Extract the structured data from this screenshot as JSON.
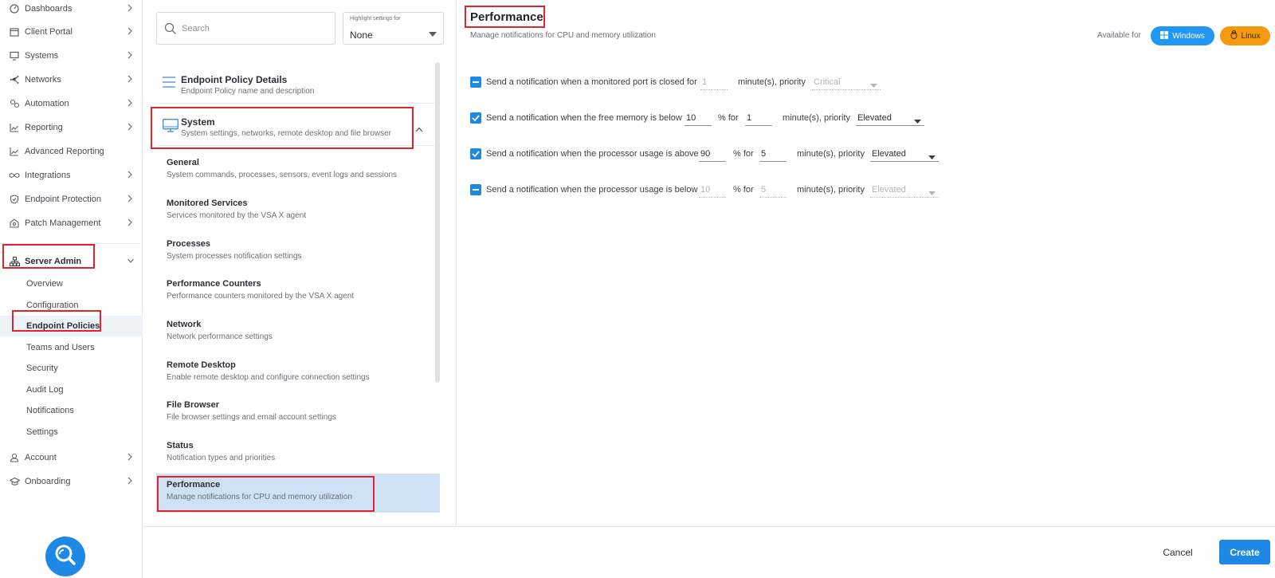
{
  "nav": {
    "items": [
      {
        "label": "Dashboards",
        "icon": "dashboard-icon"
      },
      {
        "label": "Client Portal",
        "icon": "window-icon"
      },
      {
        "label": "Systems",
        "icon": "monitor-icon"
      },
      {
        "label": "Networks",
        "icon": "network-icon"
      },
      {
        "label": "Automation",
        "icon": "automation-icon"
      },
      {
        "label": "Reporting",
        "icon": "chart-icon"
      },
      {
        "label": "Advanced Reporting",
        "icon": "chart-icon"
      },
      {
        "label": "Integrations",
        "icon": "infinity-icon"
      },
      {
        "label": "Endpoint Protection",
        "icon": "shield-icon"
      },
      {
        "label": "Patch Management",
        "icon": "patch-icon"
      }
    ],
    "server_admin": "Server Admin",
    "sub_items": [
      "Overview",
      "Configuration",
      "Endpoint Policies",
      "Teams and Users",
      "Security",
      "Audit Log",
      "Notifications",
      "Settings"
    ],
    "account": "Account",
    "onboarding": "Onboarding"
  },
  "middle": {
    "search_placeholder": "Search",
    "highlight_label": "Highlight settings for",
    "highlight_value": "None",
    "sections": [
      {
        "title": "Endpoint Policy Details",
        "desc": "Endpoint Policy name and description"
      },
      {
        "title": "System",
        "desc": "System settings, networks, remote desktop and file browser"
      }
    ],
    "entries": [
      {
        "title": "General",
        "desc": "System commands, processes, sensors, event logs and sessions"
      },
      {
        "title": "Monitored Services",
        "desc": "Services monitored by the VSA X agent"
      },
      {
        "title": "Processes",
        "desc": "System processes notification settings"
      },
      {
        "title": "Performance Counters",
        "desc": "Performance counters monitored by the VSA X agent"
      },
      {
        "title": "Network",
        "desc": "Network performance settings"
      },
      {
        "title": "Remote Desktop",
        "desc": "Enable remote desktop and configure connection settings"
      },
      {
        "title": "File Browser",
        "desc": "File browser settings and email account settings"
      },
      {
        "title": "Status",
        "desc": "Notification types and priorities"
      },
      {
        "title": "Performance",
        "desc": "Manage notifications for CPU and memory utilization"
      }
    ]
  },
  "content": {
    "title": "Performance",
    "subtitle": "Manage notifications for CPU and memory utilization",
    "available_for": "Available for",
    "windows": "Windows",
    "linux": "Linux",
    "rules": [
      {
        "text": "Send a notification when a monitored port is closed for",
        "value1": "1",
        "unit": "minute(s), priority",
        "priority": "Critical",
        "state": "partial"
      },
      {
        "text": "Send a notification when the free memory is below",
        "value1": "10",
        "mid": "% for",
        "value2": "1",
        "unit": "minute(s), priority",
        "priority": "Elevated",
        "state": "checked"
      },
      {
        "text": "Send a notification when the processor usage is above",
        "value1": "90",
        "mid": "% for",
        "value2": "5",
        "unit": "minute(s), priority",
        "priority": "Elevated",
        "state": "checked"
      },
      {
        "text": "Send a notification when the processor usage is below",
        "value1": "10",
        "mid": "% for",
        "value2": "5",
        "unit": "minute(s), priority",
        "priority": "Elevated",
        "state": "partial"
      }
    ]
  },
  "footer": {
    "cancel": "Cancel",
    "create": "Create"
  },
  "colors": {
    "accent": "#1e88e5",
    "highlight_box": "#e0242e",
    "linux": "#f59a0c",
    "selected_row": "#cfe1f5"
  }
}
